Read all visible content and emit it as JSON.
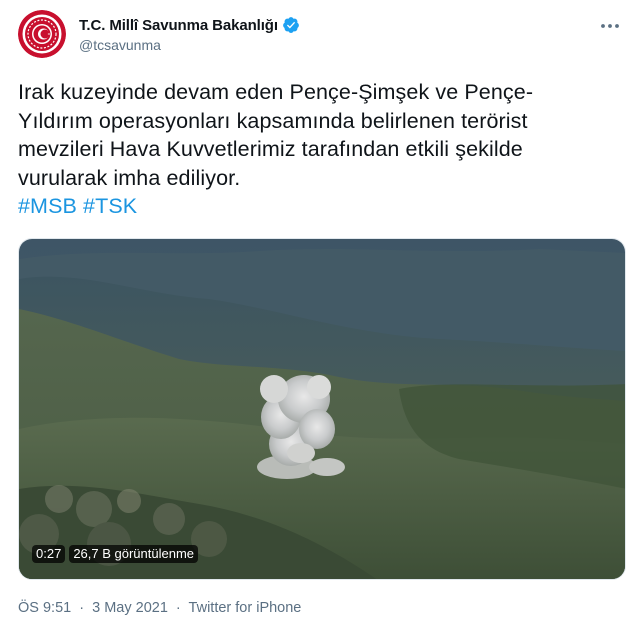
{
  "account": {
    "display_name": "T.C. Millî Savunma Bakanlığı",
    "handle": "@tcsavunma",
    "verified": true,
    "avatar_icon": "msb-emblem-icon",
    "brand_color": "#c8102e"
  },
  "tweet": {
    "text_lines": [
      "Irak kuzeyinde devam eden Pençe-Şimşek ve Pençe-",
      "Yıldırım operasyonları kapsamında belirlenen terörist",
      "mevzileri Hava Kuvvetlerimiz tarafından etkili şekilde",
      "vurularak imha ediliyor."
    ],
    "hashtags": [
      "#MSB",
      "#TSK"
    ],
    "hashtag_color": "#1b95e0"
  },
  "media": {
    "type": "video",
    "duration": "0:27",
    "views": "26,7 B görüntülenme"
  },
  "meta": {
    "time": "ÖS 9:51",
    "separator": "·",
    "date": "3 May 2021",
    "source": "Twitter for iPhone"
  },
  "colors": {
    "text_primary": "#0f1419",
    "text_secondary": "#5b7083",
    "verified_badge": "#1da1f2"
  }
}
